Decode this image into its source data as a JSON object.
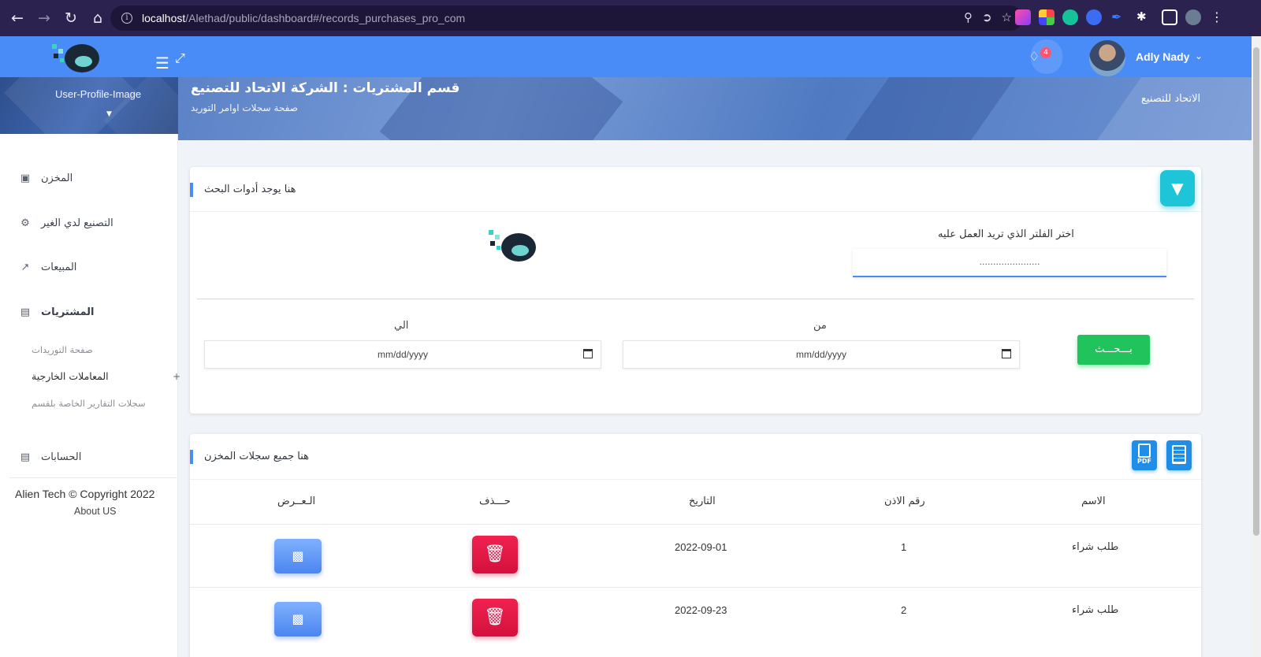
{
  "browser": {
    "url_host": "localhost",
    "url_path": "/Alethad/public/dashboard#/records_purchases_pro_com"
  },
  "header": {
    "notifications_count": "4",
    "user_name": "Adly Nady"
  },
  "sidebar": {
    "profile_image_alt": "User-Profile-Image",
    "items": [
      {
        "label": "المخزن",
        "icon": "box-icon"
      },
      {
        "label": "التصنيع لدي الغير",
        "icon": "gear-icon"
      },
      {
        "label": "المبيعات",
        "icon": "trend-icon"
      },
      {
        "label": "المشتريات",
        "icon": "card-icon"
      }
    ],
    "subitems": [
      "صفحة التوريدات",
      "المعاملات الخارجية",
      "سجلات التقارير الخاصة بلقسم"
    ],
    "accounts_label": "الحسابات",
    "copyright": "Alien Tech © Copyright 2022",
    "about": "About US"
  },
  "page": {
    "title": "قسم المشتريات : الشركة الاتحاد للتصنيع",
    "subtitle": "صفحة سجلات اوامر التوريد",
    "breadcrumb": "الاتحاد للتصنيع"
  },
  "search_card": {
    "title": "هنا يوجد أدوات البحث",
    "filter_label": "اختر الفلتر الذي تريد العمل عليه",
    "filter_value": "......................",
    "to_label": "الي",
    "from_label": "من",
    "date_placeholder": "mm/dd/yyyy",
    "search_button": "بـــحـــث"
  },
  "records_card": {
    "title": "هنا جميع سجلات المخزن",
    "pdf_label": "PDF",
    "columns": [
      "الاسم",
      "رقم الاذن",
      "التاريخ",
      "حـــذف",
      "الـعــرض"
    ],
    "rows": [
      {
        "name": "طلب شراء",
        "number": "1",
        "date": "2022-09-01"
      },
      {
        "name": "طلب شراء",
        "number": "2",
        "date": "2022-09-23"
      }
    ]
  },
  "colors": {
    "header_blue": "#4a8cf7",
    "browser_bg": "#2b2250",
    "search_green": "#21c35c",
    "delete_red": "#e0173f",
    "filter_cyan": "#1ec5d9"
  }
}
